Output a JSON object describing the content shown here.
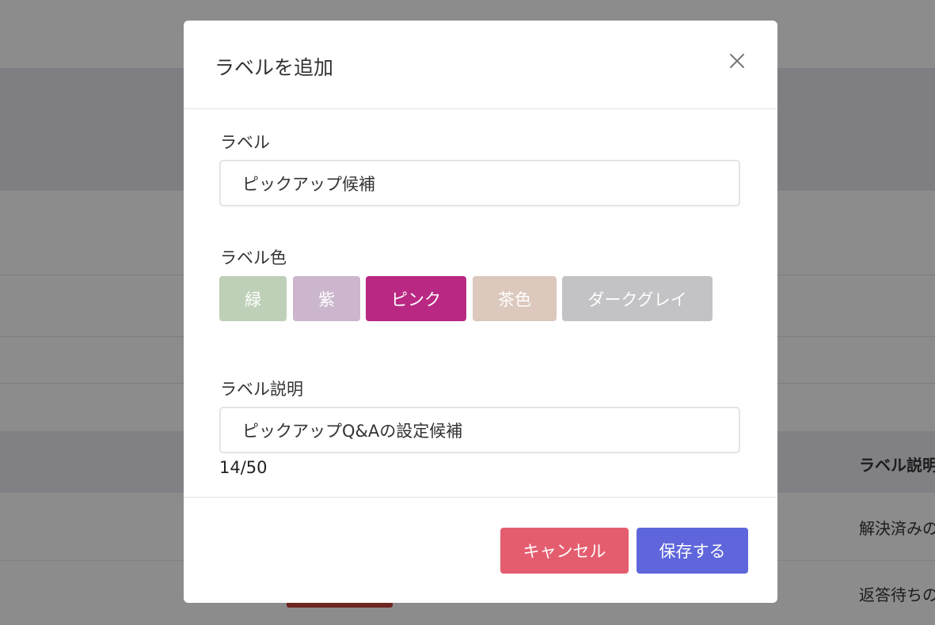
{
  "background": {
    "table_header": "ラベル説明",
    "rows": [
      "解決済みの",
      "返答待ちの"
    ]
  },
  "modal": {
    "title": "ラベルを追加",
    "close_icon": "close-icon",
    "label_field": {
      "label": "ラベル",
      "value": "ピックアップ候補"
    },
    "color_field": {
      "label": "ラベル色",
      "options": [
        {
          "name": "緑",
          "color": "#bfd0b8",
          "selected": false
        },
        {
          "name": "紫",
          "color": "#cbb6cd",
          "selected": false
        },
        {
          "name": "ピンク",
          "color": "#b92983",
          "selected": true
        },
        {
          "name": "茶色",
          "color": "#dcc8bd",
          "selected": false
        },
        {
          "name": "ダークグレイ",
          "color": "#c3c3c6",
          "selected": false
        }
      ]
    },
    "description_field": {
      "label": "ラベル説明",
      "value": "ピックアップQ&Aの設定候補",
      "counter": "14/50"
    },
    "buttons": {
      "cancel": {
        "label": "キャンセル",
        "color": "#e45d6f"
      },
      "save": {
        "label": "保存する",
        "color": "#5f66dc"
      }
    }
  }
}
